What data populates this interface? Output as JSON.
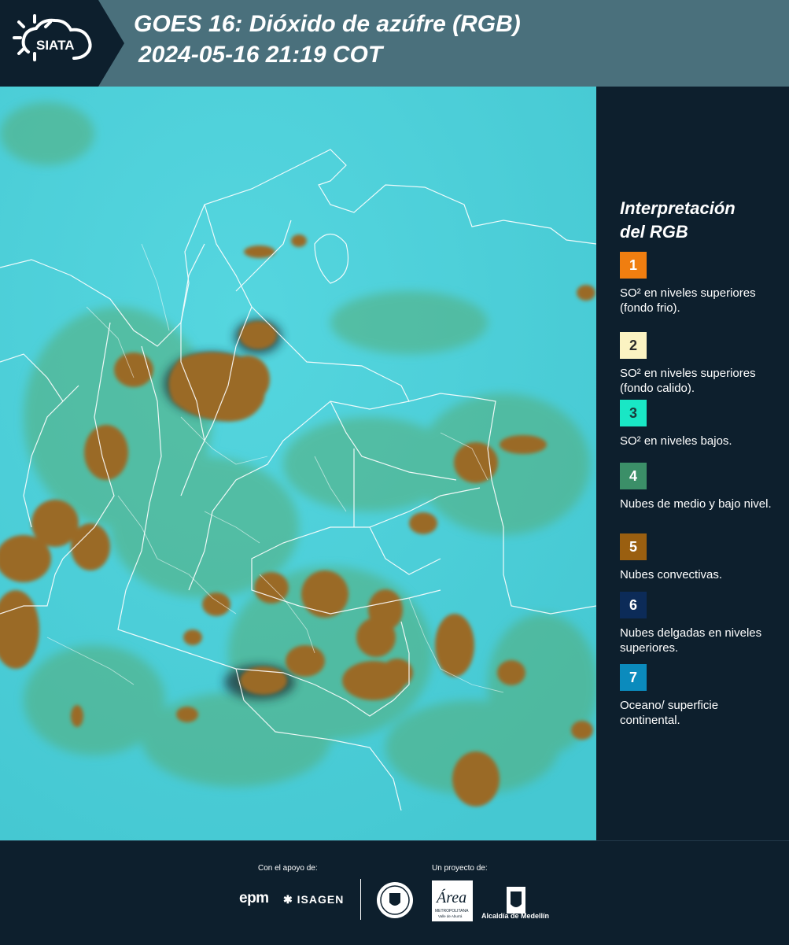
{
  "header": {
    "brand": "SIATA",
    "title_line1": "GOES 16: Dióxido de azúfre (RGB)",
    "title_line2": "2024-05-16 21:19 COT"
  },
  "legend": {
    "title_line1": "Interpretación",
    "title_line2": "del RGB",
    "items": [
      {
        "number": "1",
        "color": "#f07e10",
        "num_color": "#ffffff",
        "label": "SO² en niveles superiores (fondo frio)."
      },
      {
        "number": "2",
        "color": "#fbf3c2",
        "num_color": "#2a2a2a",
        "label": "SO² en niveles superiores (fondo calido)."
      },
      {
        "number": "3",
        "color": "#19e7c5",
        "num_color": "#1a3a3a",
        "label": "SO² en niveles bajos."
      },
      {
        "number": "4",
        "color": "#3b8f68",
        "num_color": "#ffffff",
        "label": "Nubes de medio y bajo nivel."
      },
      {
        "number": "5",
        "color": "#9a5f10",
        "num_color": "#ffffff",
        "label": "Nubes convectivas."
      },
      {
        "number": "6",
        "color": "#0c2b58",
        "num_color": "#ffffff",
        "label": "Nubes delgadas en niveles superiores."
      },
      {
        "number": "7",
        "color": "#0b8bbd",
        "num_color": "#ffffff",
        "label": "Oceano/ superficie continental."
      }
    ]
  },
  "footer": {
    "support_label": "Con el apoyo de:",
    "project_label": "Un proyecto de:",
    "sponsor1": "epm",
    "sponsor2": "ISAGEN",
    "partner_area": "Área Metropolitana Valle de Aburrá",
    "partner_alcaldia": "Alcaldía de Medellín"
  },
  "map": {
    "background_color": "#4ccfd8",
    "convective_color": "#9a6b28",
    "midlevel_color": "#4fa86c",
    "border_color": "#ffffff"
  }
}
